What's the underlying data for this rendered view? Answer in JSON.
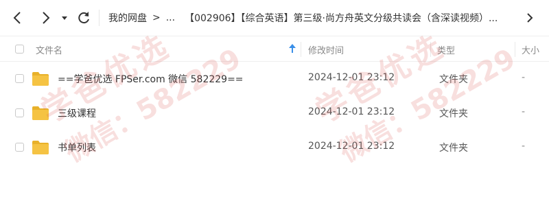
{
  "breadcrumb": {
    "root": "我的网盘",
    "separator": ">",
    "ellipsis": "...",
    "current": "【002906】【综合英语】第三级·尚方舟英文分级共读会（含深读视频）...",
    "trailing_ellipsis": "..."
  },
  "nav": {
    "back_icon": "chevron-left-icon",
    "forward_icon": "chevron-right-icon",
    "history_dropdown_icon": "caret-down-icon",
    "refresh_icon": "refresh-icon"
  },
  "columns": {
    "name": "文件名",
    "modified": "修改时间",
    "type": "类型",
    "size": "大小"
  },
  "rows": [
    {
      "name": "==学爸优选 FPSer.com 微信 582229==",
      "modified": "2024-12-01 23:12",
      "type": "文件夹",
      "size": "-"
    },
    {
      "name": "三级课程",
      "modified": "2024-12-01 23:12",
      "type": "文件夹",
      "size": "-"
    },
    {
      "name": "书单列表",
      "modified": "2024-12-01 23:12",
      "type": "文件夹",
      "size": "-"
    }
  ],
  "watermark": {
    "text_1": "学爸优选",
    "text_2": "微信：582229"
  },
  "colors": {
    "folder": "#F5C343",
    "folder_tab": "#E8B12A",
    "sort_arrow": "#3a8fe8",
    "watermark": "#d9534f"
  }
}
